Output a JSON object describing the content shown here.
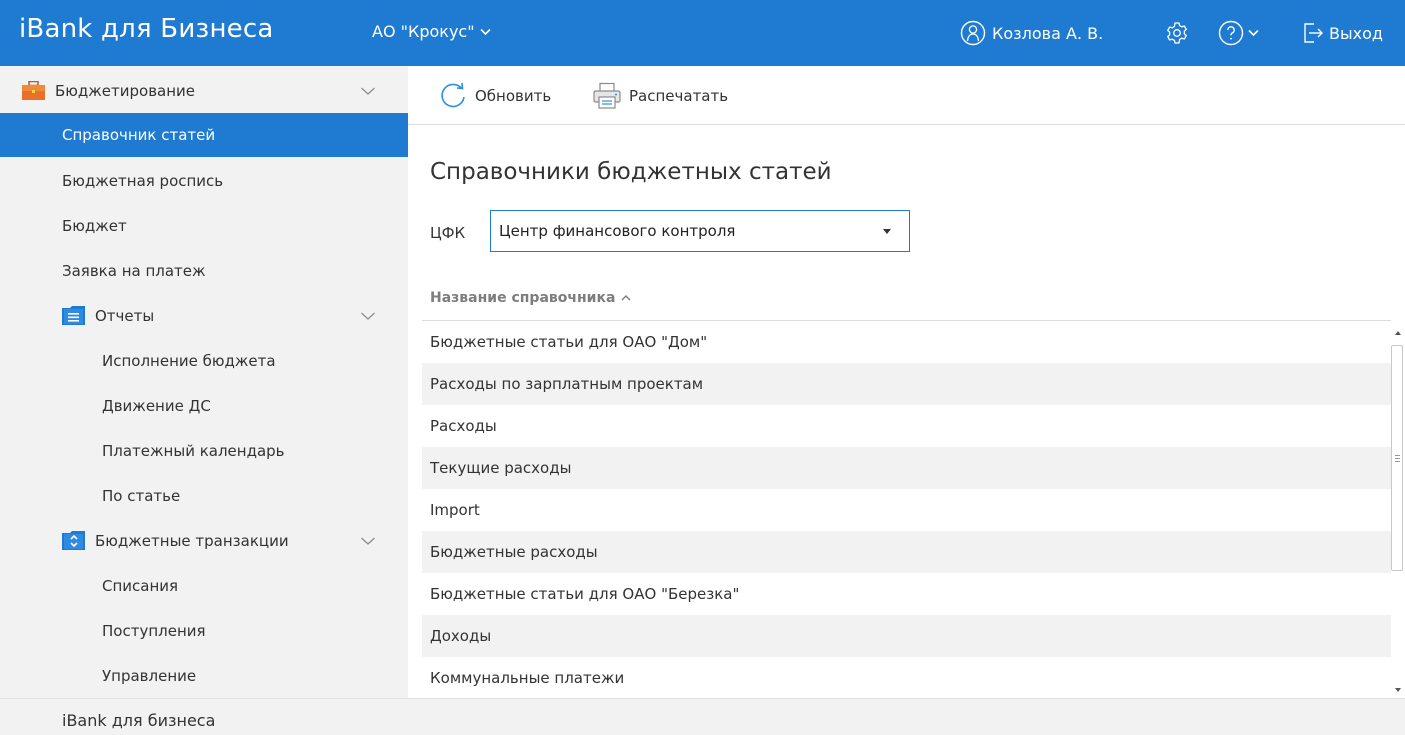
{
  "header": {
    "brand": "iBank для Бизнеса",
    "organization": "АО \"Крокус\"",
    "user_name": "Козлова А. В.",
    "logout_label": "Выход",
    "color": "#1f7ad1"
  },
  "sidebar": {
    "budgeting": {
      "label": "Бюджетирование",
      "icon": "briefcase-icon"
    },
    "items": [
      {
        "label": "Справочник статей",
        "active": true
      },
      {
        "label": "Бюджетная роспись"
      },
      {
        "label": "Бюджет"
      },
      {
        "label": "Заявка на платеж"
      }
    ],
    "reports": {
      "label": "Отчеты",
      "icon": "reports-folder-icon",
      "items": [
        {
          "label": "Исполнение бюджета"
        },
        {
          "label": "Движение ДС"
        },
        {
          "label": "Платежный календарь"
        },
        {
          "label": "По статье"
        }
      ]
    },
    "transactions": {
      "label": "Бюджетные транзакции",
      "icon": "transactions-folder-icon",
      "items": [
        {
          "label": "Списания"
        },
        {
          "label": "Поступления"
        },
        {
          "label": "Управление"
        }
      ]
    }
  },
  "toolbar": {
    "refresh_label": "Обновить",
    "print_label": "Распечатать"
  },
  "main": {
    "title": "Справочники бюджетных статей",
    "filter_label": "ЦФК",
    "filter_value": "Центр финансового контроля",
    "column_header": "Название справочника",
    "rows": [
      "Бюджетные статьи для ОАО \"Дом\"",
      "Расходы по зарплатным проектам",
      "Расходы",
      "Текущие расходы",
      "Import",
      "Бюджетные расходы",
      "Бюджетные статьи для ОАО \"Березка\"",
      "Доходы",
      "Коммунальные платежи"
    ]
  },
  "footer": {
    "label": "iBank для бизнеса"
  }
}
